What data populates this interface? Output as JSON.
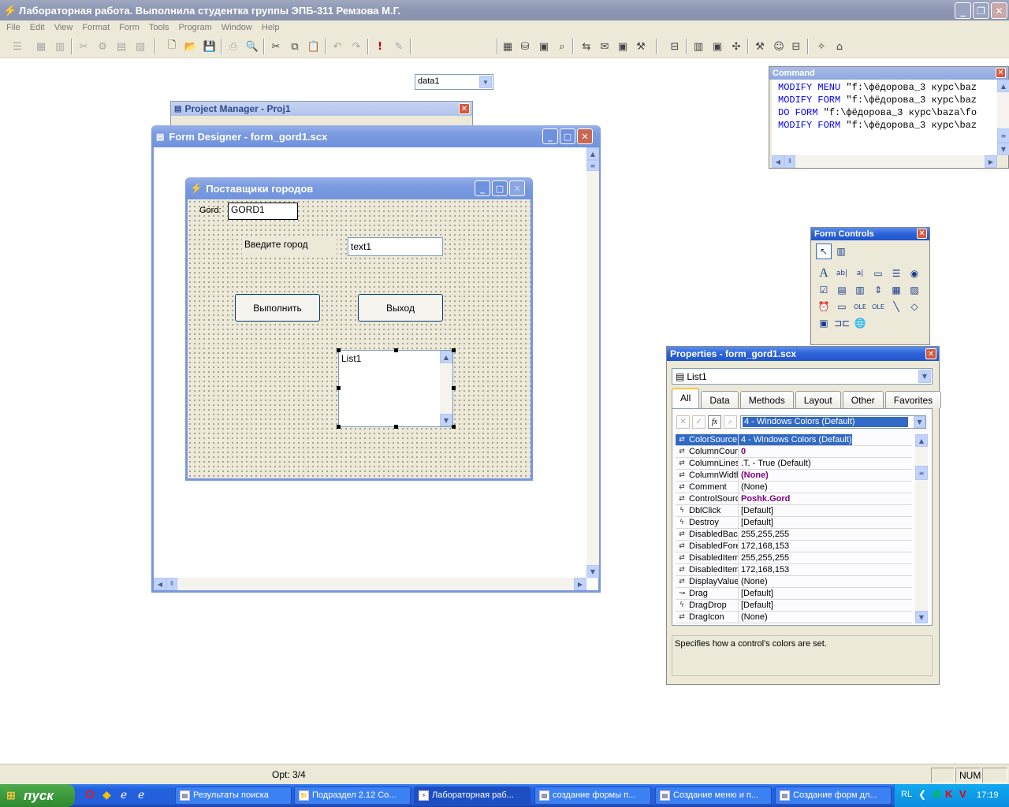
{
  "app": {
    "title": "Лабораторная работа. Выполнила студентка группы ЭПБ-311 Ремзова М.Г."
  },
  "menu": [
    "File",
    "Edit",
    "View",
    "Format",
    "Form",
    "Tools",
    "Program",
    "Window",
    "Help"
  ],
  "toolbar": {
    "datasession": "data1"
  },
  "command": {
    "title": "Command",
    "lines": [
      {
        "kw": "MODIFY MENU",
        "rest": " \"f:\\фёдорова_3 курс\\baz"
      },
      {
        "kw": "MODIFY FORM",
        "rest": " \"f:\\фёдорова_3 курс\\baz"
      },
      {
        "kw": "DO FORM",
        "rest": " \"f:\\фёдорова_3 курс\\baza\\fo"
      },
      {
        "kw": "MODIFY FORM",
        "rest": " \"f:\\фёдорова_3 курс\\baz"
      }
    ]
  },
  "project_manager": {
    "title": "Project Manager - Proj1"
  },
  "form_designer": {
    "title": "Form Designer - form_gord1.scx",
    "form": {
      "title": "Поставщики городов",
      "gord_label": "Gord:",
      "gord_value": "GORD1",
      "city_label": "Введите город",
      "text1": "text1",
      "run_button": "Выполнить",
      "exit_button": "Выход",
      "list": "List1"
    }
  },
  "form_controls": {
    "title": "Form Controls"
  },
  "properties": {
    "title": "Properties - form_gord1.scx",
    "object": "List1",
    "tabs": [
      "All",
      "Data",
      "Methods",
      "Layout",
      "Other",
      "Favorites"
    ],
    "value_editor": "4 - Windows Colors (Default)",
    "rows": [
      {
        "icon": "prop",
        "name": "ColorSource",
        "value": "4 - Windows Colors (Default)",
        "modified": false,
        "selected": true
      },
      {
        "icon": "prop",
        "name": "ColumnCount",
        "value": "0",
        "modified": true,
        "selected": false
      },
      {
        "icon": "prop",
        "name": "ColumnLines",
        "value": ".T. - True (Default)",
        "modified": false,
        "selected": false
      },
      {
        "icon": "prop",
        "name": "ColumnWidths",
        "value": "(None)",
        "modified": true,
        "selected": false
      },
      {
        "icon": "prop",
        "name": "Comment",
        "value": "(None)",
        "modified": false,
        "selected": false
      },
      {
        "icon": "prop",
        "name": "ControlSource",
        "value": "Poshk.Gord",
        "modified": true,
        "selected": false
      },
      {
        "icon": "event",
        "name": "DblClick",
        "value": "[Default]",
        "modified": false,
        "selected": false
      },
      {
        "icon": "event",
        "name": "Destroy",
        "value": "[Default]",
        "modified": false,
        "selected": false
      },
      {
        "icon": "prop",
        "name": "DisabledBackColor",
        "value": "255,255,255",
        "modified": false,
        "selected": false
      },
      {
        "icon": "prop",
        "name": "DisabledForeColor",
        "value": "172,168,153",
        "modified": false,
        "selected": false
      },
      {
        "icon": "prop",
        "name": "DisabledItemBackColor",
        "value": "255,255,255",
        "modified": false,
        "selected": false
      },
      {
        "icon": "prop",
        "name": "DisabledItemForeColor",
        "value": "172,168,153",
        "modified": false,
        "selected": false
      },
      {
        "icon": "prop",
        "name": "DisplayValue",
        "value": "(None)",
        "modified": false,
        "selected": false
      },
      {
        "icon": "method",
        "name": "Drag",
        "value": "[Default]",
        "modified": false,
        "selected": false
      },
      {
        "icon": "event",
        "name": "DragDrop",
        "value": "[Default]",
        "modified": false,
        "selected": false
      },
      {
        "icon": "prop",
        "name": "DragIcon",
        "value": "(None)",
        "modified": false,
        "selected": false
      }
    ],
    "description": "Specifies how a control's colors are set."
  },
  "statusbar": {
    "record": "Opt: 3/4",
    "num": "NUM"
  },
  "taskbar": {
    "start": "пуск",
    "tasks": [
      "Результаты поиска",
      "Подраздел 2.12 Со...",
      "Лабораторная раб...",
      "создание формы п...",
      "Создание меню и п...",
      "Создание форм дл..."
    ],
    "lang": "RL",
    "clock": "17:19"
  }
}
